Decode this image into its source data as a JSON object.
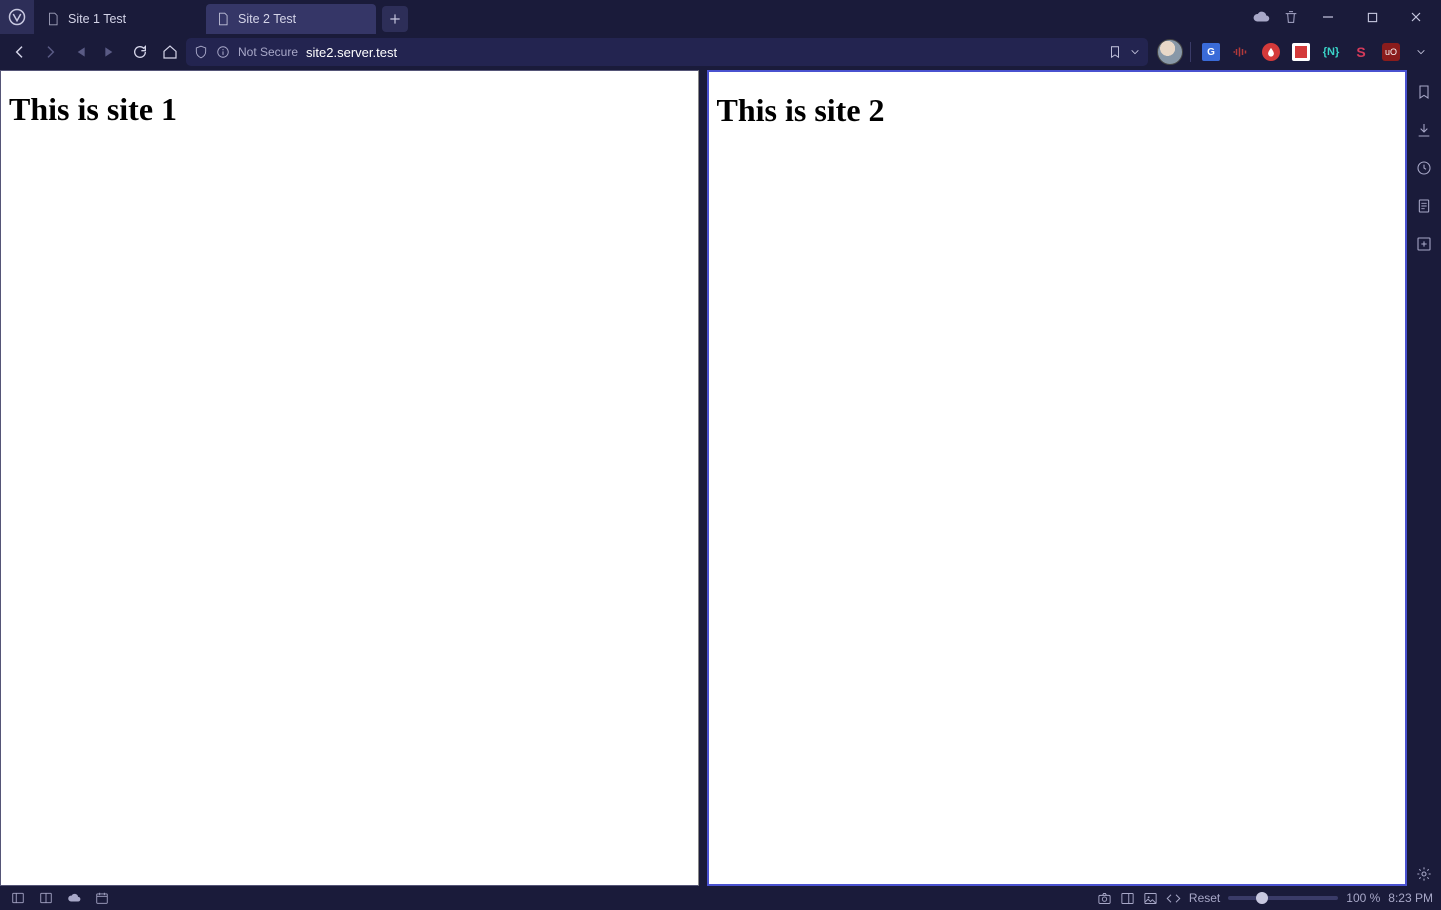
{
  "tabs": [
    {
      "label": "Site 1 Test",
      "active": false
    },
    {
      "label": "Site 2 Test",
      "active": true
    }
  ],
  "address": {
    "not_secure": "Not Secure",
    "url": "site2.server.test"
  },
  "tiles": {
    "left_heading": "This is site 1",
    "right_heading": "This is site 2"
  },
  "status": {
    "reset_label": "Reset",
    "zoom_percent": "100 %",
    "clock": "8:23 PM"
  }
}
